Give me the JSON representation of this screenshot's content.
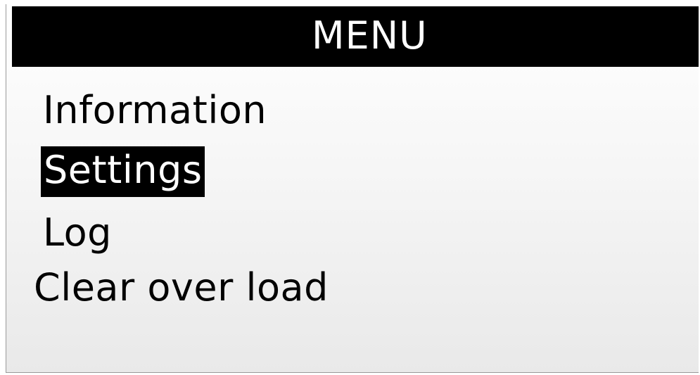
{
  "menu": {
    "title": "MENU",
    "selected_index": 1,
    "items": [
      {
        "label": "Information"
      },
      {
        "label": "Settings"
      },
      {
        "label": "Log"
      },
      {
        "label": "Clear over load"
      }
    ]
  },
  "colors": {
    "header_background": "#000000",
    "header_text": "#ffffff",
    "item_text": "#000000",
    "selected_background": "#000000",
    "selected_text": "#ffffff",
    "screen_background": "#f4f4f4"
  }
}
